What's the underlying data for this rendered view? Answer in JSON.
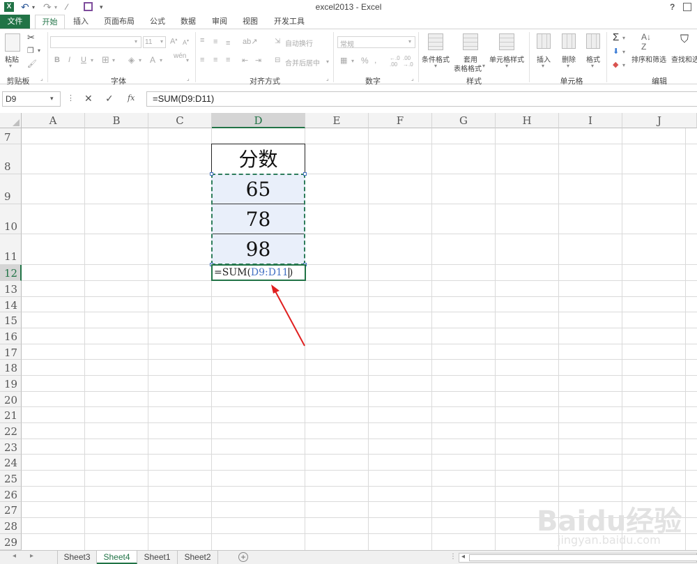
{
  "titlebar": {
    "title": "excel2013 - Excel",
    "help_icon_text": "?",
    "colors": {
      "excel_green": "#217346"
    }
  },
  "tabs": [
    {
      "label": "文件"
    },
    {
      "label": "开始"
    },
    {
      "label": "插入"
    },
    {
      "label": "页面布局"
    },
    {
      "label": "公式"
    },
    {
      "label": "数据"
    },
    {
      "label": "审阅"
    },
    {
      "label": "视图"
    },
    {
      "label": "开发工具"
    }
  ],
  "ribbon": {
    "clipboard": {
      "paste_label": "粘贴",
      "group_label": "剪贴板"
    },
    "font": {
      "size_value": "11",
      "bold": "B",
      "italic": "I",
      "underline": "U",
      "group_label": "字体"
    },
    "alignment": {
      "wrap_text": "自动换行",
      "merge_center": "合并后居中",
      "group_label": "对齐方式"
    },
    "number": {
      "format_value": "常规",
      "percent": "%",
      "group_label": "数字"
    },
    "styles": {
      "conditional": "条件格式",
      "table_format_line1": "套用",
      "table_format_line2": "表格格式",
      "cell_styles": "单元格样式",
      "group_label": "样式"
    },
    "cells": {
      "insert": "插入",
      "delete": "删除",
      "format": "格式",
      "group_label": "单元格"
    },
    "editing": {
      "sort_filter": "排序和筛选",
      "find_select": "查找和选",
      "group_label": "编辑"
    }
  },
  "formula_bar": {
    "name_box": "D9",
    "formula": "=SUM(D9:D11)",
    "fx_label": "fx"
  },
  "grid": {
    "columns": [
      "A",
      "B",
      "C",
      "D",
      "E",
      "F",
      "G",
      "H",
      "I",
      "J"
    ],
    "selected_column": "D",
    "rows": [
      "7",
      "8",
      "9",
      "10",
      "11",
      "12",
      "13",
      "14",
      "15",
      "16",
      "17",
      "18",
      "19",
      "20",
      "21",
      "22",
      "23",
      "24",
      "25",
      "26",
      "27",
      "28",
      "29"
    ],
    "selected_row": "12",
    "cells": {
      "D8": "分数",
      "D9": "65",
      "D10": "78",
      "D11": "98",
      "D12_prefix": "=SUM(",
      "D12_ref": "D9:D11",
      "D12_suffix": ")"
    },
    "colors": {
      "reference_blue": "#4472c4",
      "range_fill": "#e9effa",
      "arrow_red": "#e02020"
    }
  },
  "sheet_tabs": [
    {
      "label": "Sheet3"
    },
    {
      "label": "Sheet4"
    },
    {
      "label": "Sheet1"
    },
    {
      "label": "Sheet2"
    }
  ],
  "active_sheet": "Sheet4",
  "watermark": {
    "brand": "Baidu经验",
    "url": "jingyan.baidu.com"
  }
}
